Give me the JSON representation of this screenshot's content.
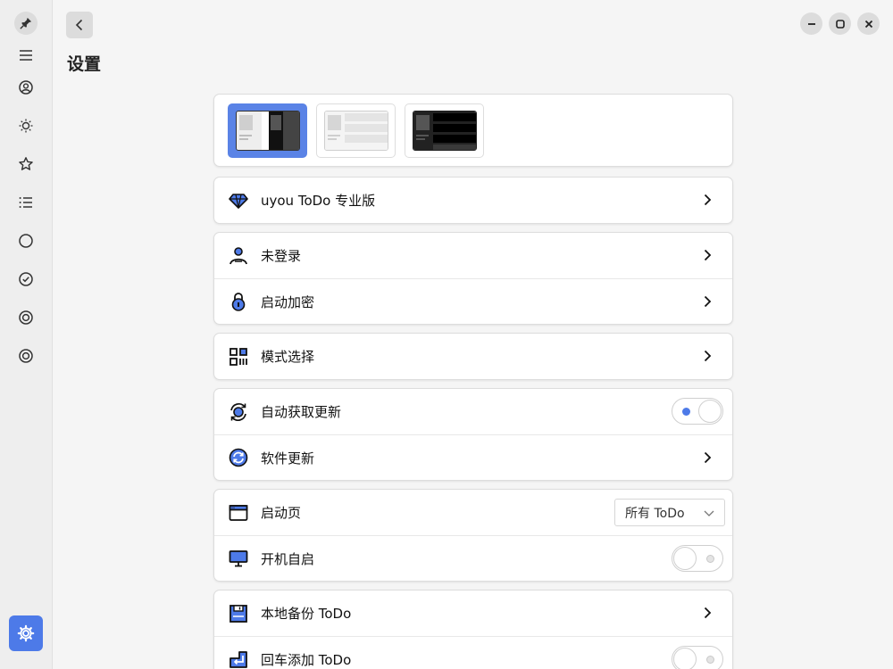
{
  "page": {
    "title": "设置"
  },
  "colors": {
    "accent": "#4d7ae8",
    "sidebar_bg": "#eeeeee",
    "content_bg": "#f5f5f5",
    "card_bg": "#ffffff"
  },
  "sidebar": {
    "items": [
      {
        "icon": "pin-icon"
      },
      {
        "icon": "menu-icon"
      },
      {
        "icon": "user-circle-icon"
      },
      {
        "icon": "sun-icon"
      },
      {
        "icon": "star-icon"
      },
      {
        "icon": "list-icon"
      },
      {
        "icon": "circle-icon"
      },
      {
        "icon": "check-circle-icon"
      },
      {
        "icon": "target-icon"
      },
      {
        "icon": "target-icon"
      },
      {
        "icon": "gear-icon"
      }
    ]
  },
  "layout_options": [
    {
      "name": "split-light-dark",
      "selected": true
    },
    {
      "name": "light",
      "selected": false
    },
    {
      "name": "dark",
      "selected": false
    }
  ],
  "groups": {
    "pro": {
      "label": "uyou ToDo 专业版",
      "icon": "diamond-icon"
    },
    "account": {
      "login": {
        "label": "未登录",
        "icon": "user-icon"
      },
      "lock": {
        "label": "启动加密",
        "icon": "lock-icon"
      }
    },
    "mode": {
      "label": "模式选择",
      "icon": "grid-icon"
    },
    "update": {
      "auto": {
        "label": "自动获取更新",
        "icon": "sync-icon",
        "enabled": true
      },
      "software": {
        "label": "软件更新",
        "icon": "refresh-icon"
      }
    },
    "startup": {
      "page": {
        "label": "启动页",
        "icon": "window-icon",
        "value": "所有 ToDo"
      },
      "autostart": {
        "label": "开机自启",
        "icon": "monitor-icon",
        "enabled": false
      }
    },
    "backup": {
      "local": {
        "label": "本地备份 ToDo",
        "icon": "save-icon"
      },
      "enter_add": {
        "label": "回车添加 ToDo",
        "icon": "enter-icon",
        "enabled": false
      }
    }
  }
}
